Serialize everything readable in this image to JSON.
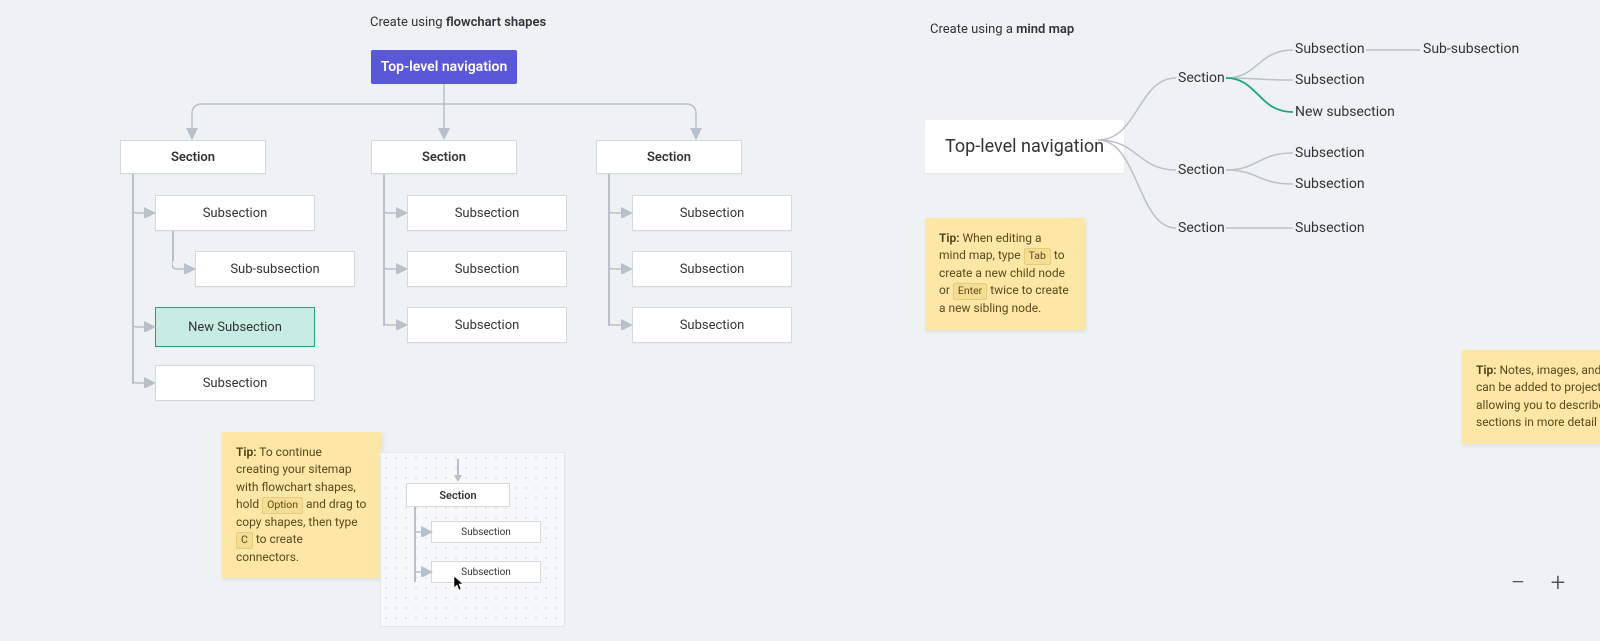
{
  "flowchart": {
    "heading_prefix": "Create using ",
    "heading_bold": "flowchart shapes",
    "root": "Top-level navigation",
    "columns": [
      {
        "section": "Section",
        "items": [
          {
            "label": "Subsection"
          },
          {
            "label": "Sub-subsection",
            "indent": true
          },
          {
            "label": "New Subsection",
            "highlight": true
          },
          {
            "label": "Subsection"
          }
        ]
      },
      {
        "section": "Section",
        "items": [
          {
            "label": "Subsection"
          },
          {
            "label": "Subsection"
          },
          {
            "label": "Subsection"
          }
        ]
      },
      {
        "section": "Section",
        "items": [
          {
            "label": "Subsection"
          },
          {
            "label": "Subsection"
          },
          {
            "label": "Subsection"
          }
        ]
      }
    ],
    "tip_prefix": "Tip:",
    "tip_part1": " To continue creating your sitemap with flowchart shapes, hold ",
    "tip_key1": "Option",
    "tip_part2": " and drag to copy shapes, then type ",
    "tip_key2": "C",
    "tip_part3": " to create connectors.",
    "mini": {
      "section": "Section",
      "sub1": "Subsection",
      "sub2": "Subsection"
    }
  },
  "mindmap": {
    "heading_prefix": "Create using a ",
    "heading_bold": "mind map",
    "root": "Top-level navigation",
    "sections": [
      {
        "label": "Section",
        "children": [
          {
            "label": "Subsection",
            "grandchild": "Sub-subsection"
          },
          {
            "label": "Subsection"
          },
          {
            "label": "New subsection",
            "new": true
          }
        ]
      },
      {
        "label": "Section",
        "children": [
          {
            "label": "Subsection"
          },
          {
            "label": "Subsection"
          }
        ]
      },
      {
        "label": "Section",
        "children": [
          {
            "label": "Subsection"
          }
        ]
      }
    ],
    "tip_prefix": "Tip:",
    "tip_part1": " When editing a mind map, type ",
    "tip_key1": "Tab",
    "tip_part2": " to create a new child node or ",
    "tip_key2": "Enter",
    "tip_part3": " twice to create a new sibling node."
  },
  "side_tip": {
    "prefix": "Tip:",
    "text": " Notes, images, and can be added to project allowing you to describe sections in more detail"
  },
  "zoom": {
    "minus": "−",
    "plus": "+"
  }
}
